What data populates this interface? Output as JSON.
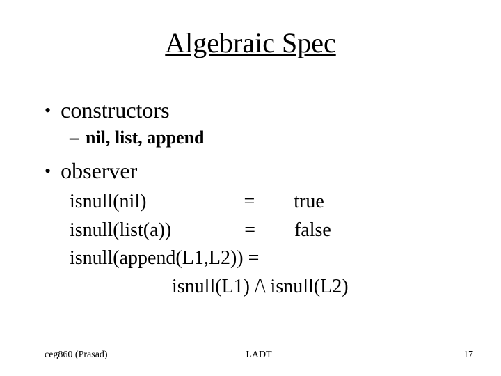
{
  "title": "Algebraic Spec",
  "bullets": {
    "constructors": "constructors",
    "constructors_sub": "nil, list, append",
    "observer": "observer"
  },
  "equations": {
    "line1": "isnull(nil)                    =        true",
    "line2": "isnull(list(a))               =        false",
    "line3": "isnull(append(L1,L2)) =",
    "line4": "                     isnull(L1) /\\ isnull(L2)"
  },
  "footer": {
    "left": "ceg860 (Prasad)",
    "center": "LADT",
    "right": "17"
  }
}
